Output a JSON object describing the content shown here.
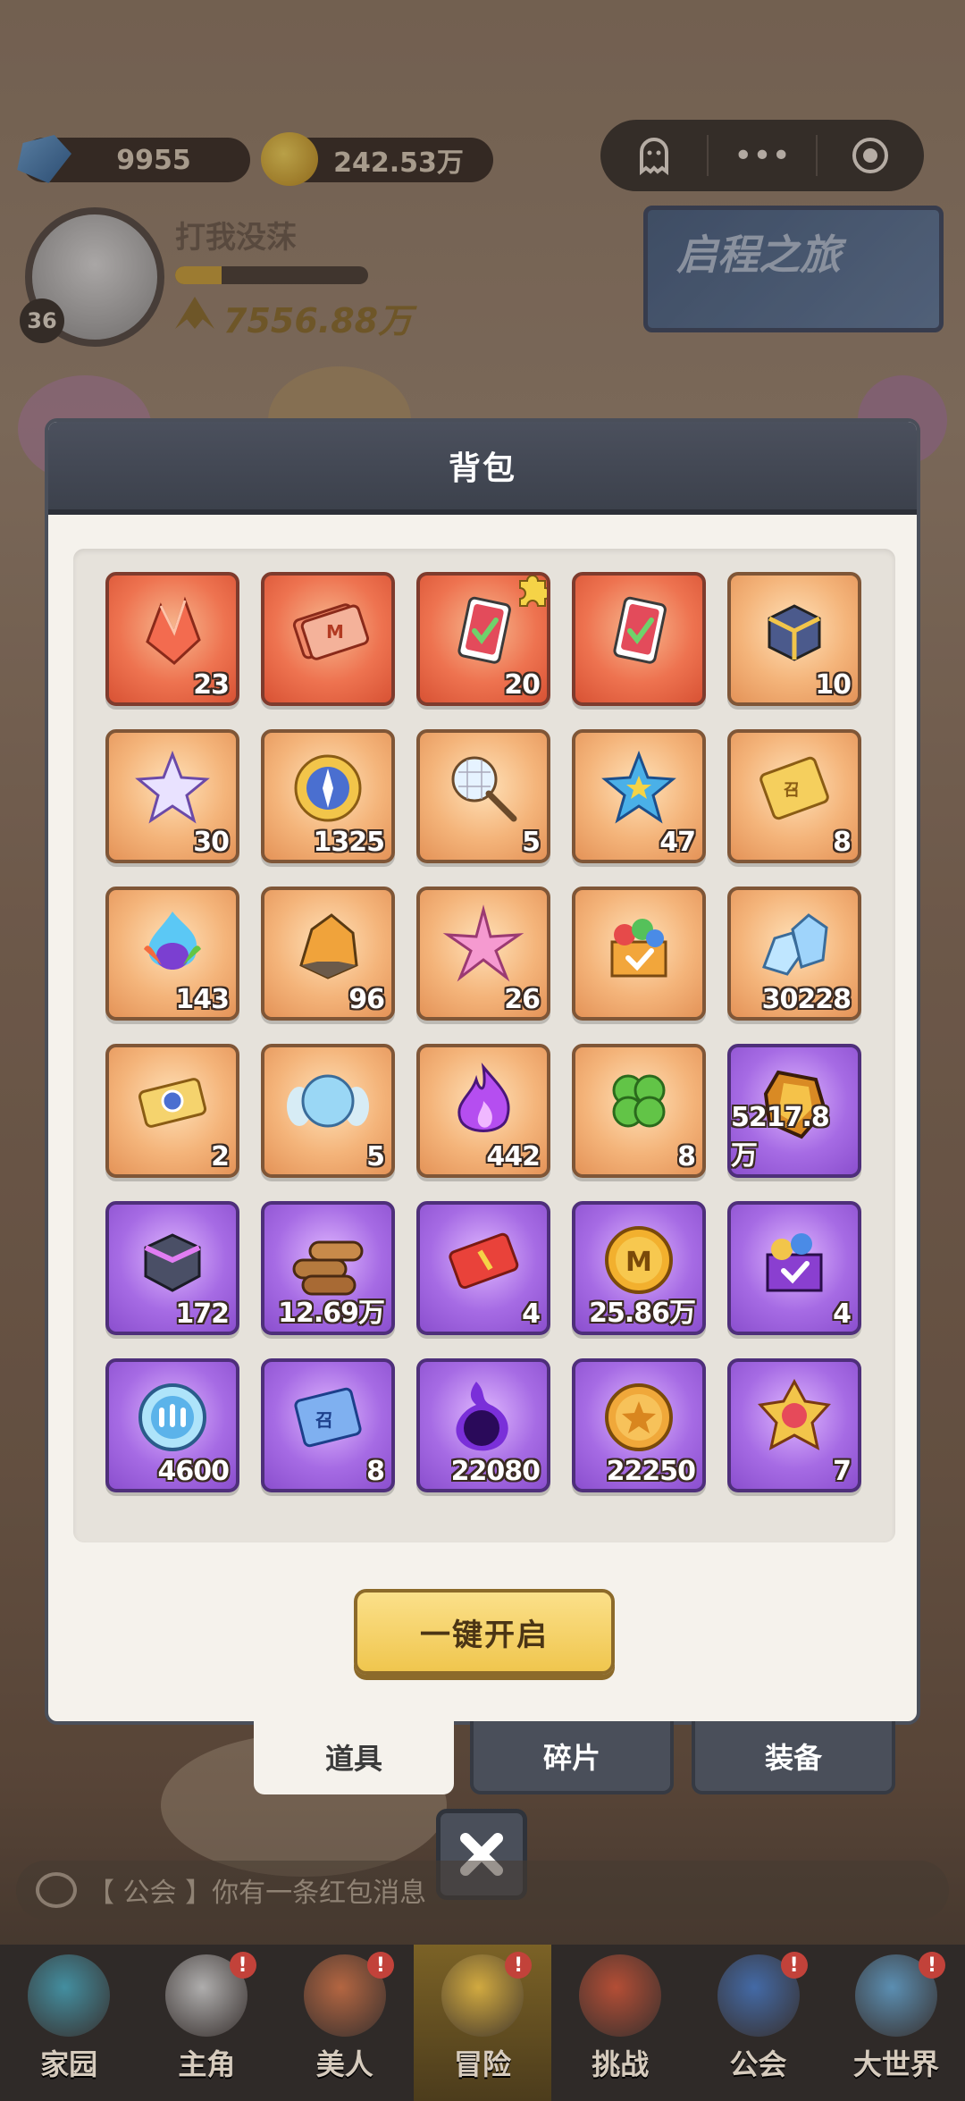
{
  "top": {
    "gems": "9955",
    "coins": "242.53万",
    "player_name": "打我没莯",
    "level": "36",
    "power": "7556.88万",
    "exp_progress": 0.24,
    "journey_banner": "启程之旅"
  },
  "capsule": {
    "ghost_icon": "ghost-icon",
    "more": "•••",
    "target_icon": "target-icon"
  },
  "modal": {
    "title": "背包",
    "open_all_label": "一键开启",
    "items": [
      {
        "qty": "23",
        "rarity": "red",
        "icon": "red-crystal-icon"
      },
      {
        "qty": "",
        "rarity": "red",
        "icon": "m-ticket-icon"
      },
      {
        "qty": "20",
        "rarity": "red",
        "icon": "card-puzzle-icon"
      },
      {
        "qty": "",
        "rarity": "red",
        "icon": "card-icon"
      },
      {
        "qty": "10",
        "rarity": "orange",
        "icon": "chest-icon"
      },
      {
        "qty": "30",
        "rarity": "orange",
        "icon": "rainbow-star-icon"
      },
      {
        "qty": "1325",
        "rarity": "orange",
        "icon": "compass-coin-icon"
      },
      {
        "qty": "5",
        "rarity": "orange",
        "icon": "net-icon"
      },
      {
        "qty": "47",
        "rarity": "orange",
        "icon": "blue-star-icon"
      },
      {
        "qty": "8",
        "rarity": "orange",
        "icon": "gold-ticket-icon"
      },
      {
        "qty": "143",
        "rarity": "orange",
        "icon": "fire-orb-icon"
      },
      {
        "qty": "96",
        "rarity": "orange",
        "icon": "ore-icon"
      },
      {
        "qty": "26",
        "rarity": "orange",
        "icon": "pink-star-icon"
      },
      {
        "qty": "",
        "rarity": "orange",
        "icon": "gift-box-icon"
      },
      {
        "qty": "30228",
        "rarity": "orange",
        "icon": "ice-crystal-icon"
      },
      {
        "qty": "2",
        "rarity": "orange",
        "icon": "wing-ticket-icon"
      },
      {
        "qty": "5",
        "rarity": "orange",
        "icon": "wing-orb-icon"
      },
      {
        "qty": "442",
        "rarity": "orange",
        "icon": "purple-flame-icon"
      },
      {
        "qty": "8",
        "rarity": "orange",
        "icon": "clover-icon"
      },
      {
        "qty": "5217.8万",
        "rarity": "purple",
        "icon": "amber-gem-icon"
      },
      {
        "qty": "172",
        "rarity": "purple",
        "icon": "purple-chest-icon"
      },
      {
        "qty": "12.69万",
        "rarity": "purple",
        "icon": "wood-icon"
      },
      {
        "qty": "4",
        "rarity": "purple",
        "icon": "red-ticket-icon"
      },
      {
        "qty": "25.86万",
        "rarity": "purple",
        "icon": "m-coin-icon"
      },
      {
        "qty": "4",
        "rarity": "purple",
        "icon": "exp-box-icon"
      },
      {
        "qty": "4600",
        "rarity": "purple",
        "icon": "blue-medal-icon"
      },
      {
        "qty": "8",
        "rarity": "purple",
        "icon": "blue-ticket-icon"
      },
      {
        "qty": "22080",
        "rarity": "purple",
        "icon": "dark-orb-icon"
      },
      {
        "qty": "22250",
        "rarity": "purple",
        "icon": "star-coin-icon"
      },
      {
        "qty": "7",
        "rarity": "purple",
        "icon": "emblem-icon"
      }
    ]
  },
  "tabs": [
    {
      "label": "道具",
      "active": true
    },
    {
      "label": "碎片",
      "active": false
    },
    {
      "label": "装备",
      "active": false
    }
  ],
  "chat": {
    "text": "【 公会 】你有一条红包消息"
  },
  "nav": [
    {
      "label": "家园",
      "badge": false
    },
    {
      "label": "主角",
      "badge": true
    },
    {
      "label": "美人",
      "badge": true
    },
    {
      "label": "冒险",
      "badge": true,
      "active": true
    },
    {
      "label": "挑战",
      "badge": false
    },
    {
      "label": "公会",
      "badge": true
    },
    {
      "label": "大世界",
      "badge": true
    }
  ],
  "colors": {
    "red_cell": "#ee7350",
    "orange_cell": "#f4b47a",
    "purple_cell": "#a66be4",
    "modal_header": "#4a4f5a",
    "button_gold": "#f0c64e"
  }
}
